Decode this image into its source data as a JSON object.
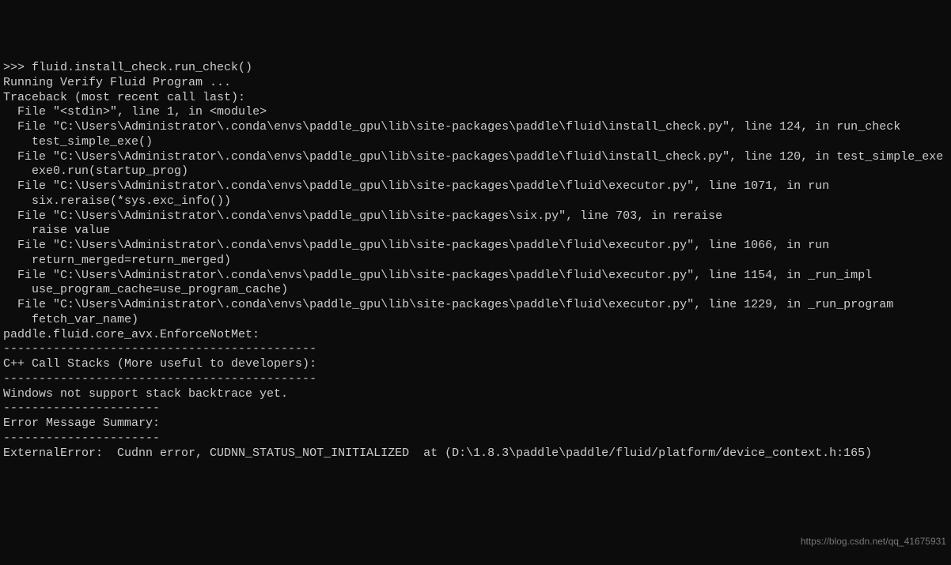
{
  "terminal": {
    "lines": [
      ">>> fluid.install_check.run_check()",
      "Running Verify Fluid Program ... ",
      "Traceback (most recent call last):",
      "  File \"<stdin>\", line 1, in <module>",
      "  File \"C:\\Users\\Administrator\\.conda\\envs\\paddle_gpu\\lib\\site-packages\\paddle\\fluid\\install_check.py\", line 124, in run_check",
      "    test_simple_exe()",
      "  File \"C:\\Users\\Administrator\\.conda\\envs\\paddle_gpu\\lib\\site-packages\\paddle\\fluid\\install_check.py\", line 120, in test_simple_exe",
      "    exe0.run(startup_prog)",
      "  File \"C:\\Users\\Administrator\\.conda\\envs\\paddle_gpu\\lib\\site-packages\\paddle\\fluid\\executor.py\", line 1071, in run",
      "    six.reraise(*sys.exc_info())",
      "  File \"C:\\Users\\Administrator\\.conda\\envs\\paddle_gpu\\lib\\site-packages\\six.py\", line 703, in reraise",
      "    raise value",
      "  File \"C:\\Users\\Administrator\\.conda\\envs\\paddle_gpu\\lib\\site-packages\\paddle\\fluid\\executor.py\", line 1066, in run",
      "    return_merged=return_merged)",
      "  File \"C:\\Users\\Administrator\\.conda\\envs\\paddle_gpu\\lib\\site-packages\\paddle\\fluid\\executor.py\", line 1154, in _run_impl",
      "    use_program_cache=use_program_cache)",
      "  File \"C:\\Users\\Administrator\\.conda\\envs\\paddle_gpu\\lib\\site-packages\\paddle\\fluid\\executor.py\", line 1229, in _run_program",
      "    fetch_var_name)",
      "paddle.fluid.core_avx.EnforceNotMet: ",
      "",
      "--------------------------------------------",
      "C++ Call Stacks (More useful to developers):",
      "--------------------------------------------",
      "Windows not support stack backtrace yet.",
      "",
      "----------------------",
      "Error Message Summary:",
      "----------------------",
      "ExternalError:  Cudnn error, CUDNN_STATUS_NOT_INITIALIZED  at (D:\\1.8.3\\paddle\\paddle/fluid/platform/device_context.h:165)"
    ]
  },
  "watermark": "https://blog.csdn.net/qq_41675931"
}
